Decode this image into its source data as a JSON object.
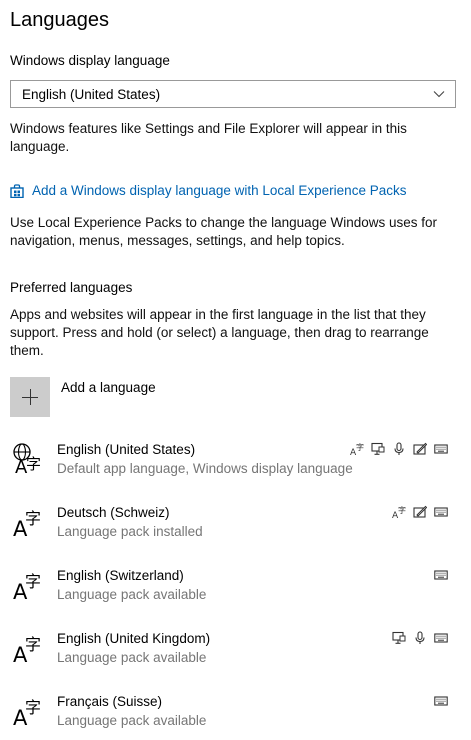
{
  "page": {
    "title": "Languages",
    "display_language_label": "Windows display language",
    "display_language_value": "English (United States)",
    "display_language_note": "Windows features like Settings and File Explorer will appear in this language.",
    "add_display_lang_link": "Add a Windows display language with Local Experience Packs",
    "lep_note": "Use Local Experience Packs to change the language Windows uses for navigation, menus, messages, settings, and help topics.",
    "preferred_label": "Preferred languages",
    "preferred_note": "Apps and websites will appear in the first language in the list that they support. Press and hold (or select) a language, then drag to rearrange them.",
    "add_language_label": "Add a language"
  },
  "languages": [
    {
      "name": "English (United States)",
      "status": "Default app language, Windows display language",
      "icon": "globe-language-icon",
      "features": [
        "text-to-speech-icon",
        "display-language-icon",
        "microphone-icon",
        "handwriting-icon",
        "keyboard-icon"
      ]
    },
    {
      "name": "Deutsch (Schweiz)",
      "status": "Language pack installed",
      "icon": "language-icon",
      "features": [
        "text-to-speech-icon",
        "handwriting-icon",
        "keyboard-icon"
      ]
    },
    {
      "name": "English (Switzerland)",
      "status": "Language pack available",
      "icon": "language-icon",
      "features": [
        "keyboard-icon"
      ]
    },
    {
      "name": "English (United Kingdom)",
      "status": "Language pack available",
      "icon": "language-icon",
      "features": [
        "display-language-icon",
        "microphone-icon",
        "keyboard-icon"
      ]
    },
    {
      "name": "Français (Suisse)",
      "status": "Language pack available",
      "icon": "language-icon",
      "features": [
        "keyboard-icon"
      ]
    }
  ],
  "colors": {
    "link": "#0063b1",
    "secondary_text": "#767676",
    "add_tile": "#cccccc"
  }
}
